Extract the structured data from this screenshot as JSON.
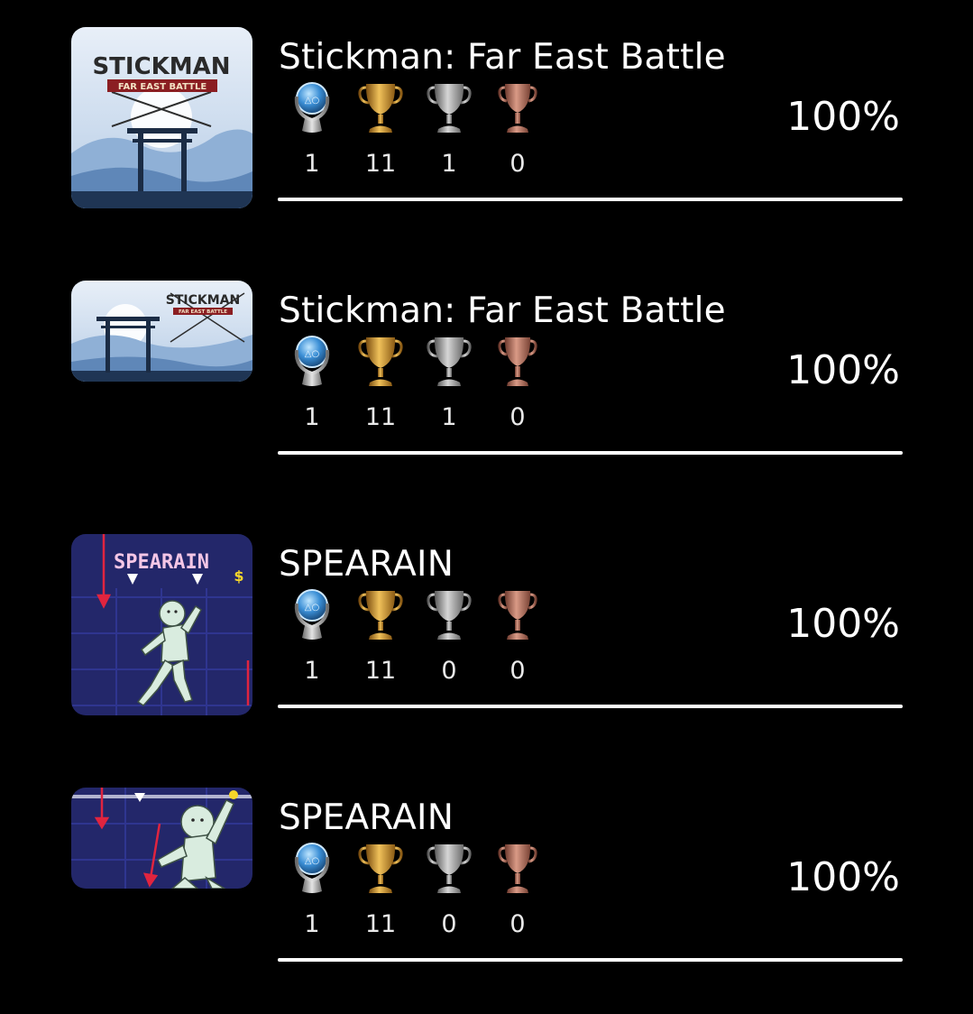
{
  "games": [
    {
      "title": "Stickman: Far East Battle",
      "art_text": "STICKMAN",
      "art_subtext": "FAR EAST BATTLE",
      "trophies": {
        "platinum": "1",
        "gold": "11",
        "silver": "1",
        "bronze": "0"
      },
      "percent_label": "100%",
      "progress": 100
    },
    {
      "title": "Stickman: Far East Battle",
      "art_text": "STICKMAN",
      "art_subtext": "FAR EAST BATTLE",
      "trophies": {
        "platinum": "1",
        "gold": "11",
        "silver": "1",
        "bronze": "0"
      },
      "percent_label": "100%",
      "progress": 100
    },
    {
      "title": "SPEARAIN",
      "art_text": "SPEARAIN",
      "trophies": {
        "platinum": "1",
        "gold": "11",
        "silver": "0",
        "bronze": "0"
      },
      "percent_label": "100%",
      "progress": 100
    },
    {
      "title": "SPEARAIN",
      "trophies": {
        "platinum": "1",
        "gold": "11",
        "silver": "0",
        "bronze": "0"
      },
      "percent_label": "100%",
      "progress": 100
    }
  ],
  "trophy_icons": [
    "platinum-trophy-icon",
    "gold-trophy-icon",
    "silver-trophy-icon",
    "bronze-trophy-icon"
  ],
  "colors": {
    "background": "#000000",
    "text": "#ffffff",
    "progress_fill": "#ffffff",
    "gold": "#c8922e",
    "silver": "#a9a9a9",
    "bronze": "#b06a5a",
    "platinum": "#3b8fd6"
  }
}
